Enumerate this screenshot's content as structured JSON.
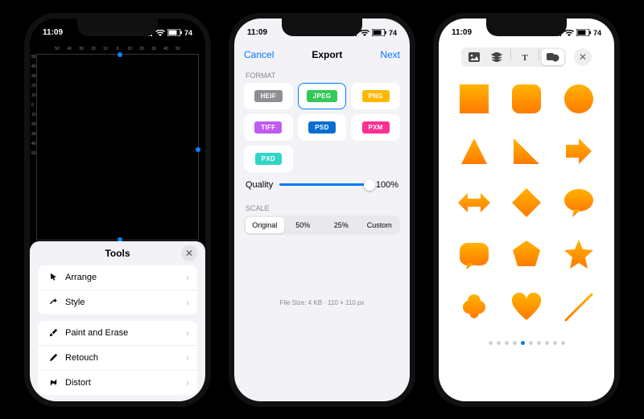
{
  "status": {
    "time": "11:09",
    "battery": "74"
  },
  "p1": {
    "ruler": [
      "50",
      "40",
      "30",
      "20",
      "10",
      "0",
      "10",
      "20",
      "30",
      "40",
      "50"
    ],
    "rulerV": [
      "50",
      "40",
      "30",
      "20",
      "10",
      "0",
      "10",
      "20",
      "30",
      "40",
      "50"
    ],
    "sheet_title": "Tools",
    "groups": [
      {
        "rows": [
          {
            "icon": "cursor",
            "label": "Arrange"
          },
          {
            "icon": "wand",
            "label": "Style"
          }
        ]
      },
      {
        "rows": [
          {
            "icon": "brush",
            "label": "Paint and Erase"
          },
          {
            "icon": "pencil",
            "label": "Retouch"
          },
          {
            "icon": "distort",
            "label": "Distort"
          }
        ]
      }
    ]
  },
  "p2": {
    "cancel": "Cancel",
    "title": "Export",
    "next": "Next",
    "format_h": "FORMAT",
    "formats": [
      {
        "label": "HEIF",
        "color": "#8e8e93",
        "sel": false
      },
      {
        "label": "JPEG",
        "color": "#34c759",
        "sel": true
      },
      {
        "label": "PNG",
        "color": "#ffb800",
        "sel": false
      },
      {
        "label": "TIFF",
        "color": "#bf5af2",
        "sel": false
      },
      {
        "label": "PSD",
        "color": "#0a6ed1",
        "sel": false
      },
      {
        "label": "PXM",
        "color": "#ff2d92",
        "sel": false
      },
      {
        "label": "PXD",
        "color": "#30d5c8",
        "sel": false
      }
    ],
    "quality_label": "Quality",
    "quality_pct": "100%",
    "quality_val": 100,
    "scale_h": "SCALE",
    "scales": [
      {
        "label": "Original",
        "sel": true
      },
      {
        "label": "50%",
        "sel": false
      },
      {
        "label": "25%",
        "sel": false
      },
      {
        "label": "Custom",
        "sel": false
      }
    ],
    "footer": "File Size: 4 KB · 110 × 110 px"
  },
  "p3": {
    "tabs": [
      {
        "icon": "image",
        "sel": false
      },
      {
        "icon": "layers",
        "sel": false
      },
      {
        "icon": "text",
        "sel": false
      },
      {
        "icon": "shape",
        "sel": true
      }
    ],
    "shapes": [
      "square",
      "rounded",
      "circle",
      "triangle",
      "rtriangle",
      "arrow-r",
      "arrow-lr",
      "diamond",
      "speech",
      "rounded2",
      "poly",
      "star",
      "cloud",
      "heart",
      "line"
    ],
    "dots": 10,
    "active_dot": 4
  }
}
